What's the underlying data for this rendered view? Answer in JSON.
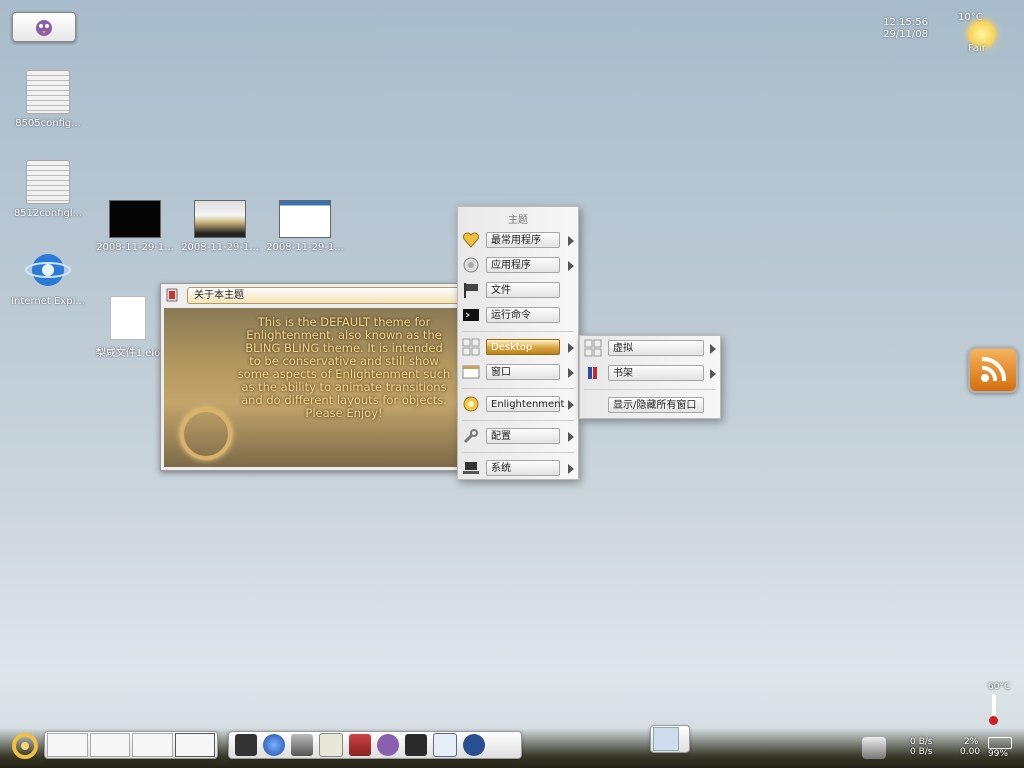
{
  "desktop": {
    "icons": [
      {
        "label": "8505config..."
      },
      {
        "label": "8512configl..."
      },
      {
        "label": "Internet Expl..."
      },
      {
        "label": "2008-11-29-1..."
      },
      {
        "label": "2008-11-29-1..."
      },
      {
        "label": "2008-11-29-1..."
      },
      {
        "label": "梨咸文件1.eio"
      }
    ]
  },
  "clock": {
    "time": "12:15:56",
    "date": "29/11/08"
  },
  "weather": {
    "temp": "10°C",
    "condition": "Fair"
  },
  "about_window": {
    "title": "关于本主题",
    "lines": [
      "This is the DEFAULT theme for",
      "Enlightenment, also known as the",
      "BLING BLING theme. It is intended",
      "to be conservative and still show",
      "some aspects of Enlightenment such",
      "as the ability to animate transitions",
      "and do different layouts for objects.",
      "Please Enjoy!"
    ]
  },
  "main_menu": {
    "title": "主题",
    "items": [
      {
        "label": "最常用程序",
        "icon": "heart-icon"
      },
      {
        "label": "应用程序",
        "icon": "gear-icon"
      },
      {
        "label": "文件",
        "icon": "flag-icon"
      },
      {
        "label": "运行命令",
        "icon": "terminal-icon"
      },
      {
        "label": "Desktop",
        "icon": "desktop-grid-icon",
        "selected": true
      },
      {
        "label": "窗口",
        "icon": "window-icon"
      },
      {
        "label": "Enlightenment",
        "icon": "enlightenment-icon"
      },
      {
        "label": "配置",
        "icon": "wrench-icon"
      },
      {
        "label": "系统",
        "icon": "laptop-icon"
      }
    ]
  },
  "submenu": {
    "items": [
      {
        "label": "虚拟",
        "icon": "desktop-grid-icon"
      },
      {
        "label": "书架",
        "icon": "shelf-icon"
      },
      {
        "label": "显示/隐藏所有窗口"
      }
    ]
  },
  "system": {
    "temperature": "60°C",
    "net_in": "0 B/s",
    "net_out": "0 B/s",
    "cpu": "2%",
    "cpu2": "0.00",
    "battery": "99%"
  },
  "colors": {
    "accent": "#d9a440",
    "rss": "#e88a22"
  }
}
